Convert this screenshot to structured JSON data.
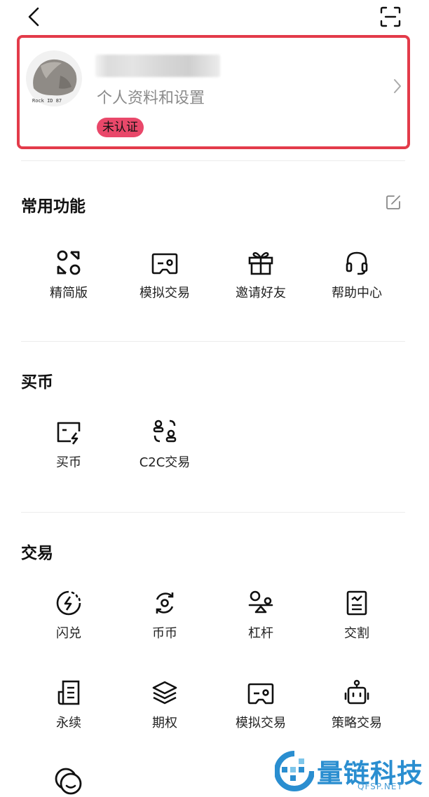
{
  "profile": {
    "subtitle": "个人资料和设置",
    "badge": "未认证",
    "avatar_caption": "Rock ID 87"
  },
  "sections": {
    "common": {
      "title": "常用功能",
      "items": [
        {
          "label": "精简版",
          "icon": "lite-mode-icon"
        },
        {
          "label": "模拟交易",
          "icon": "gamepad-icon"
        },
        {
          "label": "邀请好友",
          "icon": "gift-icon"
        },
        {
          "label": "帮助中心",
          "icon": "headset-icon"
        }
      ]
    },
    "buy": {
      "title": "买币",
      "items": [
        {
          "label": "买币",
          "icon": "lightning-card-icon"
        },
        {
          "label": "C2C交易",
          "icon": "p2p-users-icon"
        }
      ]
    },
    "trade": {
      "title": "交易",
      "items": [
        {
          "label": "闪兑",
          "icon": "flash-swap-icon"
        },
        {
          "label": "币币",
          "icon": "coin-exchange-icon"
        },
        {
          "label": "杠杆",
          "icon": "leverage-icon"
        },
        {
          "label": "交割",
          "icon": "delivery-icon"
        },
        {
          "label": "永续",
          "icon": "perpetual-icon"
        },
        {
          "label": "期权",
          "icon": "options-layers-icon"
        },
        {
          "label": "模拟交易",
          "icon": "gamepad-icon"
        },
        {
          "label": "策略交易",
          "icon": "robot-icon"
        }
      ]
    }
  },
  "watermark": {
    "text": "量链科技",
    "sub": "QFSP.NET"
  },
  "colors": {
    "highlight_border": "#e33b4a",
    "badge_bg": "#e9486a",
    "watermark": "#2a8ed0"
  }
}
